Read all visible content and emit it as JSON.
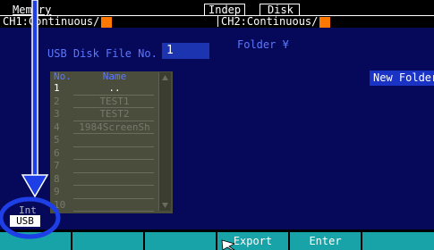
{
  "status": {
    "menu_label": "Memory",
    "mode_indep": "Indep",
    "mode_disk": "Disk",
    "ch1_label": "CH1:Continuous/",
    "ch2_label": "CH2:Continuous/"
  },
  "disk": {
    "file_no_label": "USB Disk File No.",
    "file_no_value": "1",
    "folder_label": "Folder ¥",
    "columns": {
      "no": "No.",
      "name": "Name"
    },
    "rows": [
      {
        "no": "1",
        "name": "..",
        "selected": true
      },
      {
        "no": "2",
        "name": "TEST1"
      },
      {
        "no": "3",
        "name": "TEST2"
      },
      {
        "no": "4",
        "name": "1984ScreenSh"
      },
      {
        "no": "5",
        "name": ""
      },
      {
        "no": "6",
        "name": ""
      },
      {
        "no": "7",
        "name": ""
      },
      {
        "no": "8",
        "name": ""
      },
      {
        "no": "9",
        "name": ""
      },
      {
        "no": "10",
        "name": ""
      }
    ],
    "new_folder_label": "New Folder"
  },
  "media": {
    "int_label": "Int",
    "usb_label": "USB",
    "selected": "USB"
  },
  "softkeys": [
    "",
    "",
    "",
    "Export",
    "Enter",
    ""
  ],
  "colors": {
    "background": "#06085a",
    "accent_blue": "#1a33c4",
    "softkey": "#17a3a8",
    "channel_marker": "#ff7800",
    "annotation": "#1e3fe6"
  },
  "icons": {
    "annotation_arrow": "down-arrow-icon",
    "cursor": "pointer-icon"
  }
}
